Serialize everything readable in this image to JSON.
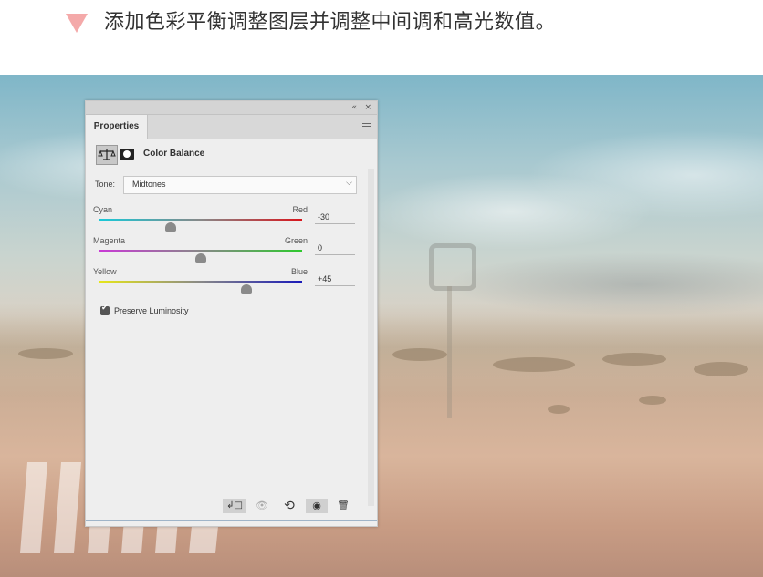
{
  "caption": {
    "text": "添加色彩平衡调整图层并调整中间调和高光数值。",
    "marker_color": "#f4a9a9"
  },
  "panel": {
    "collapse_glyph": "«",
    "close_glyph": "×",
    "tab_label": "Properties",
    "menu_icon": "panel-menu-icon",
    "adjustment_icon": "color-balance-icon",
    "mask_icon": "layer-mask-icon",
    "title": "Color Balance",
    "tone": {
      "label": "Tone:",
      "value": "Midtones",
      "caret": "⌵"
    },
    "sliders": [
      {
        "left_label": "Cyan",
        "right_label": "Red",
        "value": "-30",
        "level": -30,
        "min": -100,
        "max": 100,
        "left_color": "#19c9d8",
        "right_color": "#d8161d"
      },
      {
        "left_label": "Magenta",
        "right_label": "Green",
        "value": "0",
        "level": 0,
        "min": -100,
        "max": 100,
        "left_color": "#c93ad6",
        "right_color": "#2ec92e"
      },
      {
        "left_label": "Yellow",
        "right_label": "Blue",
        "value": "+45",
        "level": 45,
        "min": -100,
        "max": 100,
        "left_color": "#e6e61a",
        "right_color": "#1a1ab8"
      }
    ],
    "preserve_luminosity": {
      "label": "Preserve Luminosity",
      "checked": true,
      "check_glyph": "✔"
    },
    "bottom_icons": [
      {
        "name": "clip-to-layer-icon",
        "glyph": "↲□"
      },
      {
        "name": "view-previous-state-icon",
        "glyph": "👁"
      },
      {
        "name": "reset-icon",
        "glyph": "⟲"
      },
      {
        "name": "toggle-visibility-icon",
        "glyph": "◉"
      },
      {
        "name": "delete-icon",
        "glyph": "🗑"
      }
    ]
  }
}
